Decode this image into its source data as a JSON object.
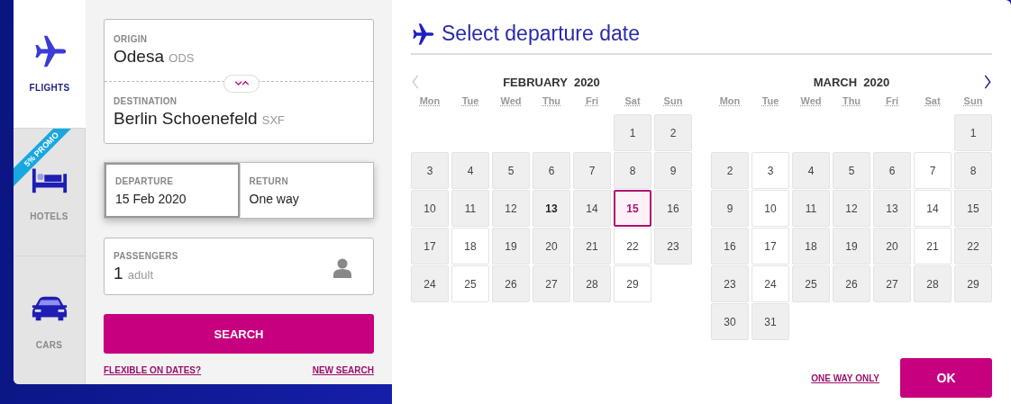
{
  "nav": [
    {
      "label": "FLIGHTS",
      "kind": "flight",
      "selected": true
    },
    {
      "label": "HOTELS",
      "kind": "hotel",
      "selected": false,
      "promo": "5% PROMO"
    },
    {
      "label": "CARS",
      "kind": "car",
      "selected": false
    }
  ],
  "origin": {
    "label": "ORIGIN",
    "city": "Odesa",
    "code": "ODS"
  },
  "destination": {
    "label": "DESTINATION",
    "city": "Berlin Schoenefeld",
    "code": "SXF"
  },
  "departure": {
    "label": "DEPARTURE",
    "value": "15 Feb 2020",
    "selected": true
  },
  "return": {
    "label": "RETURN",
    "value": "One way",
    "selected": false
  },
  "passengers": {
    "label": "PASSENGERS",
    "count": "1",
    "unit": "adult"
  },
  "search_button": "SEARCH",
  "links": [
    "FLEXIBLE ON DATES?",
    "NEW SEARCH"
  ],
  "calendar": {
    "title": "Select departure date",
    "prev_disabled": true,
    "months": [
      {
        "name": "FEBRUARY  2020",
        "weekdays": [
          "Mon",
          "Tue",
          "Wed",
          "Thu",
          "Fri",
          "Sat",
          "Sun"
        ],
        "weeks": [
          {
            "days": [
              {
                "d": "1",
                "available": false,
                "selected": false,
                "today": false
              },
              {
                "d": "2",
                "available": false,
                "selected": false,
                "today": false
              }
            ]
          },
          {
            "days": [
              {
                "d": "3",
                "available": false,
                "selected": false,
                "today": false
              },
              {
                "d": "4",
                "available": false,
                "selected": false,
                "today": false
              },
              {
                "d": "5",
                "available": false,
                "selected": false,
                "today": false
              },
              {
                "d": "6",
                "available": false,
                "selected": false,
                "today": false
              },
              {
                "d": "7",
                "available": false,
                "selected": false,
                "today": false
              },
              {
                "d": "8",
                "available": false,
                "selected": false,
                "today": false
              },
              {
                "d": "9",
                "available": false,
                "selected": false,
                "today": false
              }
            ]
          },
          {
            "days": [
              {
                "d": "10",
                "available": false,
                "selected": false,
                "today": false
              },
              {
                "d": "11",
                "available": false,
                "selected": false,
                "today": false
              },
              {
                "d": "12",
                "available": false,
                "selected": false,
                "today": false
              },
              {
                "d": "13",
                "available": false,
                "selected": false,
                "today": true
              },
              {
                "d": "14",
                "available": false,
                "selected": false,
                "today": false
              },
              {
                "d": "15",
                "available": true,
                "selected": true,
                "today": false
              },
              {
                "d": "16",
                "available": false,
                "selected": false,
                "today": false
              }
            ]
          },
          {
            "days": [
              {
                "d": "17",
                "available": false,
                "selected": false,
                "today": false
              },
              {
                "d": "18",
                "available": true,
                "selected": false,
                "today": false
              },
              {
                "d": "19",
                "available": false,
                "selected": false,
                "today": false
              },
              {
                "d": "20",
                "available": false,
                "selected": false,
                "today": false
              },
              {
                "d": "21",
                "available": false,
                "selected": false,
                "today": false
              },
              {
                "d": "22",
                "available": true,
                "selected": false,
                "today": false
              },
              {
                "d": "23",
                "available": false,
                "selected": false,
                "today": false
              }
            ]
          },
          {
            "days": [
              {
                "d": "24",
                "available": false,
                "selected": false,
                "today": false
              },
              {
                "d": "25",
                "available": true,
                "selected": false,
                "today": false
              },
              {
                "d": "26",
                "available": false,
                "selected": false,
                "today": false
              },
              {
                "d": "27",
                "available": false,
                "selected": false,
                "today": false
              },
              {
                "d": "28",
                "available": false,
                "selected": false,
                "today": false
              },
              {
                "d": "29",
                "available": true,
                "selected": false,
                "today": false
              }
            ]
          }
        ]
      },
      {
        "name": "MARCH  2020",
        "weekdays": [
          "Mon",
          "Tue",
          "Wed",
          "Thu",
          "Fri",
          "Sat",
          "Sun"
        ],
        "weeks": [
          {
            "days": [
              {
                "d": "1",
                "available": false,
                "selected": false,
                "today": false
              }
            ]
          },
          {
            "days": [
              {
                "d": "2",
                "available": false,
                "selected": false,
                "today": false
              },
              {
                "d": "3",
                "available": true,
                "selected": false,
                "today": false
              },
              {
                "d": "4",
                "available": false,
                "selected": false,
                "today": false
              },
              {
                "d": "5",
                "available": false,
                "selected": false,
                "today": false
              },
              {
                "d": "6",
                "available": false,
                "selected": false,
                "today": false
              },
              {
                "d": "7",
                "available": true,
                "selected": false,
                "today": false
              },
              {
                "d": "8",
                "available": false,
                "selected": false,
                "today": false
              }
            ]
          },
          {
            "days": [
              {
                "d": "9",
                "available": false,
                "selected": false,
                "today": false
              },
              {
                "d": "10",
                "available": true,
                "selected": false,
                "today": false
              },
              {
                "d": "11",
                "available": false,
                "selected": false,
                "today": false
              },
              {
                "d": "12",
                "available": false,
                "selected": false,
                "today": false
              },
              {
                "d": "13",
                "available": false,
                "selected": false,
                "today": false
              },
              {
                "d": "14",
                "available": true,
                "selected": false,
                "today": false
              },
              {
                "d": "15",
                "available": false,
                "selected": false,
                "today": false
              }
            ]
          },
          {
            "days": [
              {
                "d": "16",
                "available": false,
                "selected": false,
                "today": false
              },
              {
                "d": "17",
                "available": true,
                "selected": false,
                "today": false
              },
              {
                "d": "18",
                "available": false,
                "selected": false,
                "today": false
              },
              {
                "d": "19",
                "available": false,
                "selected": false,
                "today": false
              },
              {
                "d": "20",
                "available": false,
                "selected": false,
                "today": false
              },
              {
                "d": "21",
                "available": true,
                "selected": false,
                "today": false
              },
              {
                "d": "22",
                "available": false,
                "selected": false,
                "today": false
              }
            ]
          },
          {
            "days": [
              {
                "d": "23",
                "available": false,
                "selected": false,
                "today": false
              },
              {
                "d": "24",
                "available": true,
                "selected": false,
                "today": false
              },
              {
                "d": "25",
                "available": false,
                "selected": false,
                "today": false
              },
              {
                "d": "26",
                "available": false,
                "selected": false,
                "today": false
              },
              {
                "d": "27",
                "available": false,
                "selected": false,
                "today": false
              },
              {
                "d": "28",
                "available": false,
                "selected": false,
                "today": false
              },
              {
                "d": "29",
                "available": false,
                "selected": false,
                "today": false
              }
            ]
          },
          {
            "days": [
              {
                "d": "30",
                "available": false,
                "selected": false,
                "today": false
              },
              {
                "d": "31",
                "available": false,
                "selected": false,
                "today": false
              }
            ]
          }
        ]
      }
    ],
    "one_way_link": "ONE WAY ONLY",
    "ok_button": "OK"
  }
}
